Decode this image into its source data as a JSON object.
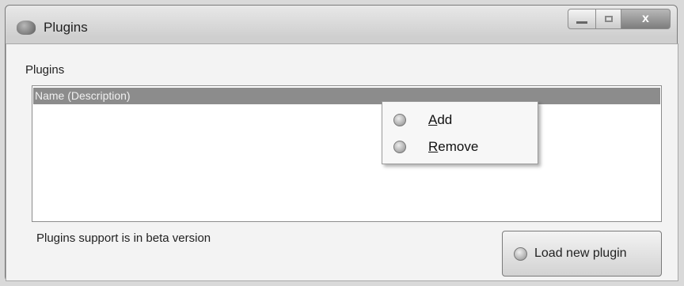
{
  "window": {
    "title": "Plugins",
    "close_glyph": "x"
  },
  "plugins_group": {
    "label": "Plugins"
  },
  "list": {
    "header": "Name (Description)"
  },
  "context_menu": {
    "items": [
      {
        "label": "Add",
        "icon": "add-icon"
      },
      {
        "label": "Remove",
        "icon": "remove-icon"
      }
    ]
  },
  "footer": {
    "status": "Plugins support is in beta version",
    "load_button": "Load new plugin"
  }
}
